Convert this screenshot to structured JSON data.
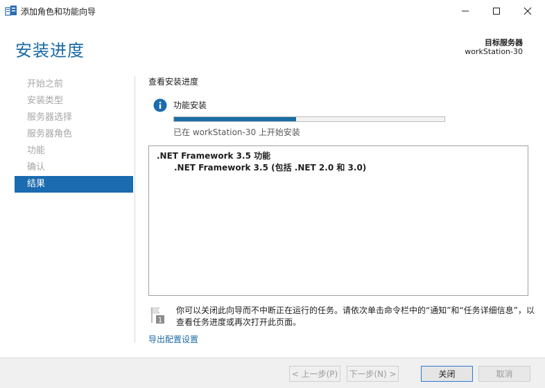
{
  "window": {
    "title": "添加角色和功能向导"
  },
  "header": {
    "page_title": "安装进度",
    "target_label": "目标服务器",
    "target_value": "workStation-30"
  },
  "nav": {
    "items": [
      {
        "label": "开始之前",
        "state": "disabled"
      },
      {
        "label": "安装类型",
        "state": "disabled"
      },
      {
        "label": "服务器选择",
        "state": "disabled"
      },
      {
        "label": "服务器角色",
        "state": "disabled"
      },
      {
        "label": "功能",
        "state": "disabled"
      },
      {
        "label": "确认",
        "state": "disabled"
      },
      {
        "label": "结果",
        "state": "active"
      }
    ]
  },
  "progress_section": {
    "title": "查看安装进度",
    "feature_label": "功能安装",
    "progress_fraction": 0.45,
    "status": "已在 workStation-30 上开始安装"
  },
  "results": {
    "main": ".NET Framework 3.5 功能",
    "sub": ".NET Framework 3.5 (包括 .NET 2.0 和 3.0)"
  },
  "note": {
    "text": "你可以关闭此向导而不中断正在运行的任务。请依次单击命令栏中的“通知”和“任务详细信息”，以查看任务进度或再次打开此页面。",
    "icon_badge": "1"
  },
  "export_link": "导出配置设置",
  "footer": {
    "prev": "< 上一步(P)",
    "next": "下一步(N) >",
    "close": "关闭",
    "cancel": "取消"
  },
  "colors": {
    "accent": "#1b6bb0",
    "title_blue": "#1a6aa6",
    "progress": "#1b6ea4"
  }
}
